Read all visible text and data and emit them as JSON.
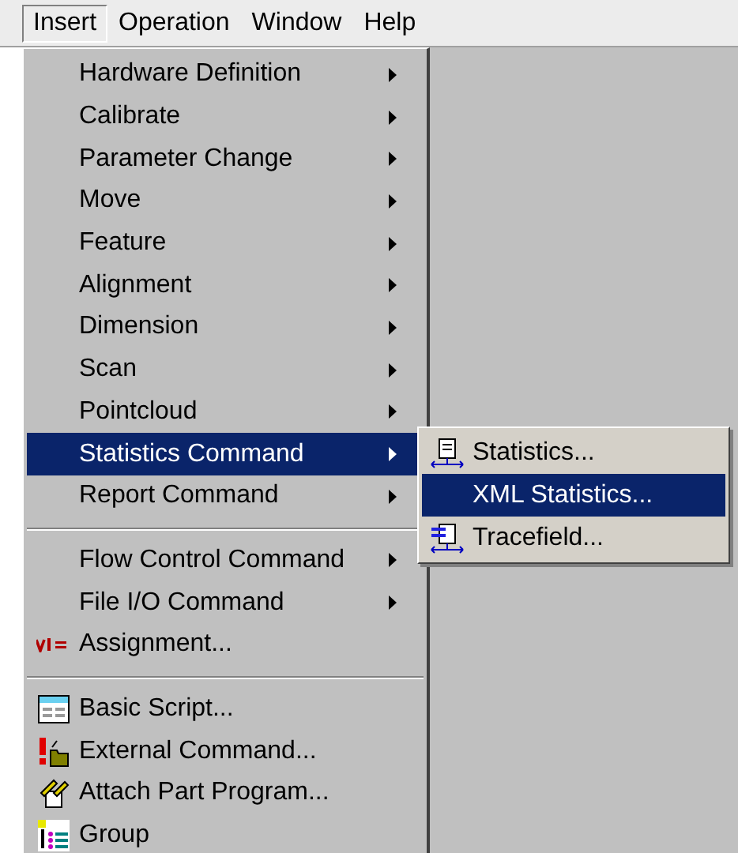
{
  "menubar": [
    {
      "label": "Insert",
      "selected": true
    },
    {
      "label": "Operation",
      "selected": false
    },
    {
      "label": "Window",
      "selected": false
    },
    {
      "label": "Help",
      "selected": false
    }
  ],
  "menu": [
    {
      "kind": "item",
      "label": "Hardware Definition",
      "submenu": true,
      "selected": false
    },
    {
      "kind": "item",
      "label": "Calibrate",
      "submenu": true,
      "selected": false
    },
    {
      "kind": "item",
      "label": "Parameter Change",
      "submenu": true,
      "selected": false
    },
    {
      "kind": "item",
      "label": "Move",
      "submenu": true,
      "selected": false
    },
    {
      "kind": "item",
      "label": "Feature",
      "submenu": true,
      "selected": false
    },
    {
      "kind": "item",
      "label": "Alignment",
      "submenu": true,
      "selected": false
    },
    {
      "kind": "item",
      "label": "Dimension",
      "submenu": true,
      "selected": false
    },
    {
      "kind": "item",
      "label": "Scan",
      "submenu": true,
      "selected": false
    },
    {
      "kind": "item",
      "label": "Pointcloud",
      "submenu": true,
      "selected": false
    },
    {
      "kind": "item",
      "label": "Statistics Command",
      "submenu": true,
      "selected": true
    },
    {
      "kind": "item",
      "label": "Report Command",
      "submenu": true,
      "selected": false
    },
    {
      "kind": "separator"
    },
    {
      "kind": "item",
      "label": "Flow Control Command",
      "submenu": true,
      "selected": false
    },
    {
      "kind": "item",
      "label": "File I/O Command",
      "submenu": true,
      "selected": false
    },
    {
      "kind": "item",
      "label": "Assignment...",
      "submenu": false,
      "selected": false
    },
    {
      "kind": "separator"
    },
    {
      "kind": "item",
      "label": "Basic Script...",
      "submenu": false,
      "selected": false
    },
    {
      "kind": "item",
      "label": "External Command...",
      "submenu": false,
      "selected": false
    },
    {
      "kind": "item",
      "label": "Attach Part Program...",
      "submenu": false,
      "selected": false
    },
    {
      "kind": "item",
      "label": "Group",
      "submenu": false,
      "selected": false
    }
  ],
  "submenu": [
    {
      "label": "Statistics...",
      "selected": false
    },
    {
      "label": "XML Statistics...",
      "selected": true
    },
    {
      "label": "Tracefield...",
      "selected": false
    }
  ]
}
